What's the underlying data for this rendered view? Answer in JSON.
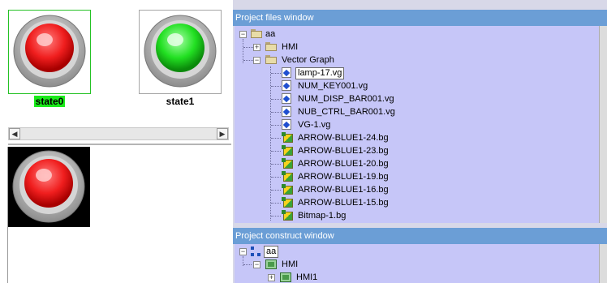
{
  "left_panel": {
    "states": [
      {
        "label": "state0",
        "color": "red",
        "selected": true
      },
      {
        "label": "state1",
        "color": "green",
        "selected": false
      }
    ]
  },
  "project_files": {
    "title": "Project files window",
    "root": "aa",
    "items": [
      {
        "label": "HMI",
        "type": "folder",
        "expander": "+"
      },
      {
        "label": "Vector Graph",
        "type": "folder",
        "expander": "-"
      },
      {
        "label": "lamp-17.vg",
        "type": "vg",
        "selected": true
      },
      {
        "label": "NUM_KEY001.vg",
        "type": "vg"
      },
      {
        "label": "NUM_DISP_BAR001.vg",
        "type": "vg"
      },
      {
        "label": "NUB_CTRL_BAR001.vg",
        "type": "vg"
      },
      {
        "label": "VG-1.vg",
        "type": "vg"
      },
      {
        "label": "ARROW-BLUE1-24.bg",
        "type": "bg"
      },
      {
        "label": "ARROW-BLUE1-23.bg",
        "type": "bg"
      },
      {
        "label": "ARROW-BLUE1-20.bg",
        "type": "bg"
      },
      {
        "label": "ARROW-BLUE1-19.bg",
        "type": "bg"
      },
      {
        "label": "ARROW-BLUE1-16.bg",
        "type": "bg"
      },
      {
        "label": "ARROW-BLUE1-15.bg",
        "type": "bg"
      },
      {
        "label": "Bitmap-1.bg",
        "type": "bg"
      }
    ]
  },
  "project_construct": {
    "title": "Project construct window",
    "root": "aa",
    "items": [
      {
        "label": "HMI",
        "expander": "-"
      },
      {
        "label": "HMI1",
        "expander": "+"
      }
    ]
  },
  "colors": {
    "title_bar": "#6b9ed6",
    "tree_bg": "#c6c6f8",
    "selected_state_bg": "#1aeb1a",
    "lamp_red": "#f01e1e",
    "lamp_green": "#22e022"
  }
}
